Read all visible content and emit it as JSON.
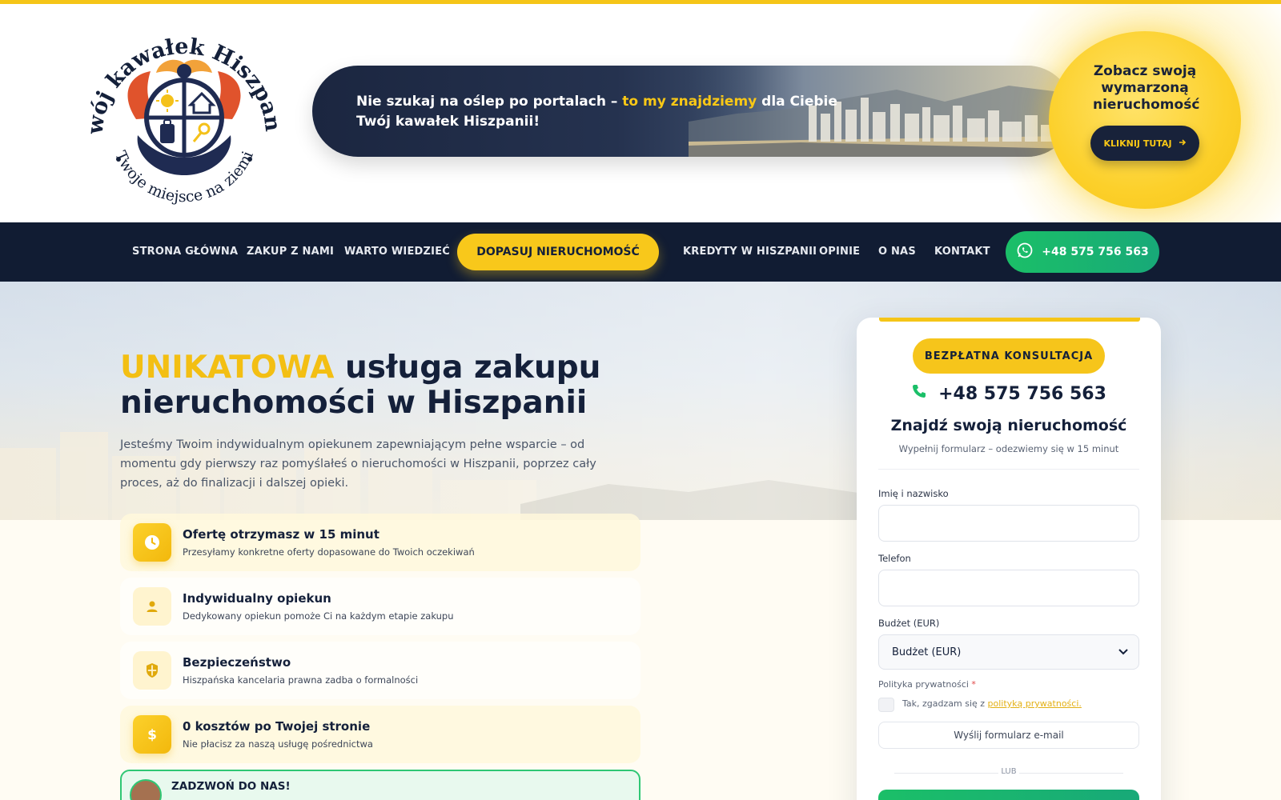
{
  "brand": {
    "logo_title": "Twój kawałek Hiszpanii",
    "logo_subtitle": "Twoje miejsce na ziemi"
  },
  "banner": {
    "line1_prefix": "Nie szukaj na oślep po portalach – ",
    "line1_highlight": "to my znajdziemy",
    "line1_suffix": " dla Ciebie",
    "line2": "Twój kawałek Hiszpanii!"
  },
  "cta": {
    "text": "Zobacz swoją wymarzoną nieruchomość",
    "button_label": "KLIKNIJ TUTAJ"
  },
  "nav": {
    "items": [
      "STRONA GŁÓWNA",
      "ZAKUP Z NAMI",
      "WARTO WIEDZIEĆ",
      "KREDYTY W HISZPANII",
      "OPINIE",
      "O NAS",
      "KONTAKT"
    ],
    "highlight": "DOPASUJ NIERUCHOMOŚĆ",
    "phone": "+48 575 756 563"
  },
  "hero": {
    "title_accent": "UNIKATOWA",
    "title_rest": " usługa zakupu nieruchomości w Hiszpanii",
    "description": "Jesteśmy Twoim indywidualnym opiekunem zapewniającym pełne wsparcie – od momentu gdy pierwszy raz pomyślałeś o nieruchomości w Hiszpanii, poprzez cały proces, aż do finalizacji i dalszej opieki."
  },
  "features": [
    {
      "title": "Ofertę otrzymasz w 15 minut",
      "desc": "Przesyłamy konkretne oferty dopasowane do Twoich oczekiwań",
      "icon": "clock-icon"
    },
    {
      "title": "Indywidualny opiekun",
      "desc": "Dedykowany opiekun pomoże Ci na każdym etapie zakupu",
      "icon": "user-icon"
    },
    {
      "title": "Bezpieczeństwo",
      "desc": "Hiszpańska kancelaria prawna zadba o formalności",
      "icon": "shield-icon"
    },
    {
      "title": "0 kosztów po Twojej stronie",
      "desc": "Nie płacisz za naszą usługę pośrednictwa",
      "icon": "dollar-icon"
    }
  ],
  "call_box": {
    "title": "ZADZWOŃ DO NAS!"
  },
  "form": {
    "badge": "BEZPŁATNA KONSULTACJA",
    "phone": "+48 575 756 563",
    "title": "Znajdź swoją nieruchomość",
    "subtitle": "Wypełnij formularz – odezwiemy się w 15 minut",
    "name_label": "Imię i nazwisko",
    "phone_label": "Telefon",
    "budget_label": "Budżet (EUR)",
    "budget_selected": "Budżet (EUR)",
    "privacy_label": "Polityka prywatności",
    "required_mark": "*",
    "consent_prefix": "Tak, zgadzam się z ",
    "consent_link": "polityką prywatności.",
    "send_label": "Wyślij formularz e-mail",
    "or_label": "LUB"
  },
  "colors": {
    "accent_yellow": "#f6c51b",
    "navy": "#111c33",
    "green": "#1bbf68"
  }
}
